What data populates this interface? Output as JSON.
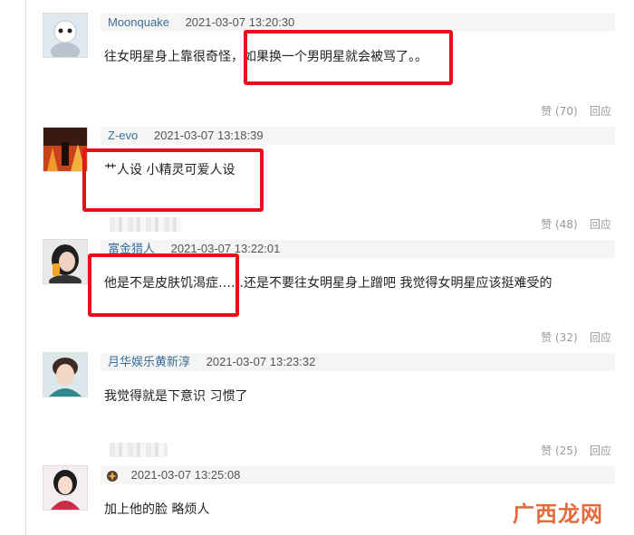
{
  "comments": [
    {
      "user": "Moonquake",
      "time": "2021-03-07 13:20:30",
      "text": "往女明星身上靠很奇怪，如果换一个男明星就会被骂了。。",
      "likes": "赞 (70)",
      "reply": "回应"
    },
    {
      "user": "Z-evo",
      "time": "2021-03-07 13:18:39",
      "text": "艹人设 小精灵可爱人设",
      "likes": "赞 (48)",
      "reply": "回应"
    },
    {
      "user": "富金猎人",
      "time": "2021-03-07 13:22:01",
      "text": "他是不是皮肤饥渴症……还是不要往女明星身上蹭吧 我觉得女明星应该挺难受的",
      "likes": "赞 (32)",
      "reply": "回应"
    },
    {
      "user": "月华娱乐黄新淳",
      "time": "2021-03-07 13:23:32",
      "text": "我觉得就是下意识 习惯了",
      "likes": "赞 (25)",
      "reply": "回应"
    },
    {
      "user": "",
      "time": "2021-03-07 13:25:08",
      "text": "加上他的脸 略烦人",
      "likes": "",
      "reply": ""
    }
  ],
  "watermark": "广西龙网",
  "colors": {
    "highlight": "#e8101a",
    "username": "#3c6c9c",
    "meta_bg": "#f3f6f3"
  }
}
